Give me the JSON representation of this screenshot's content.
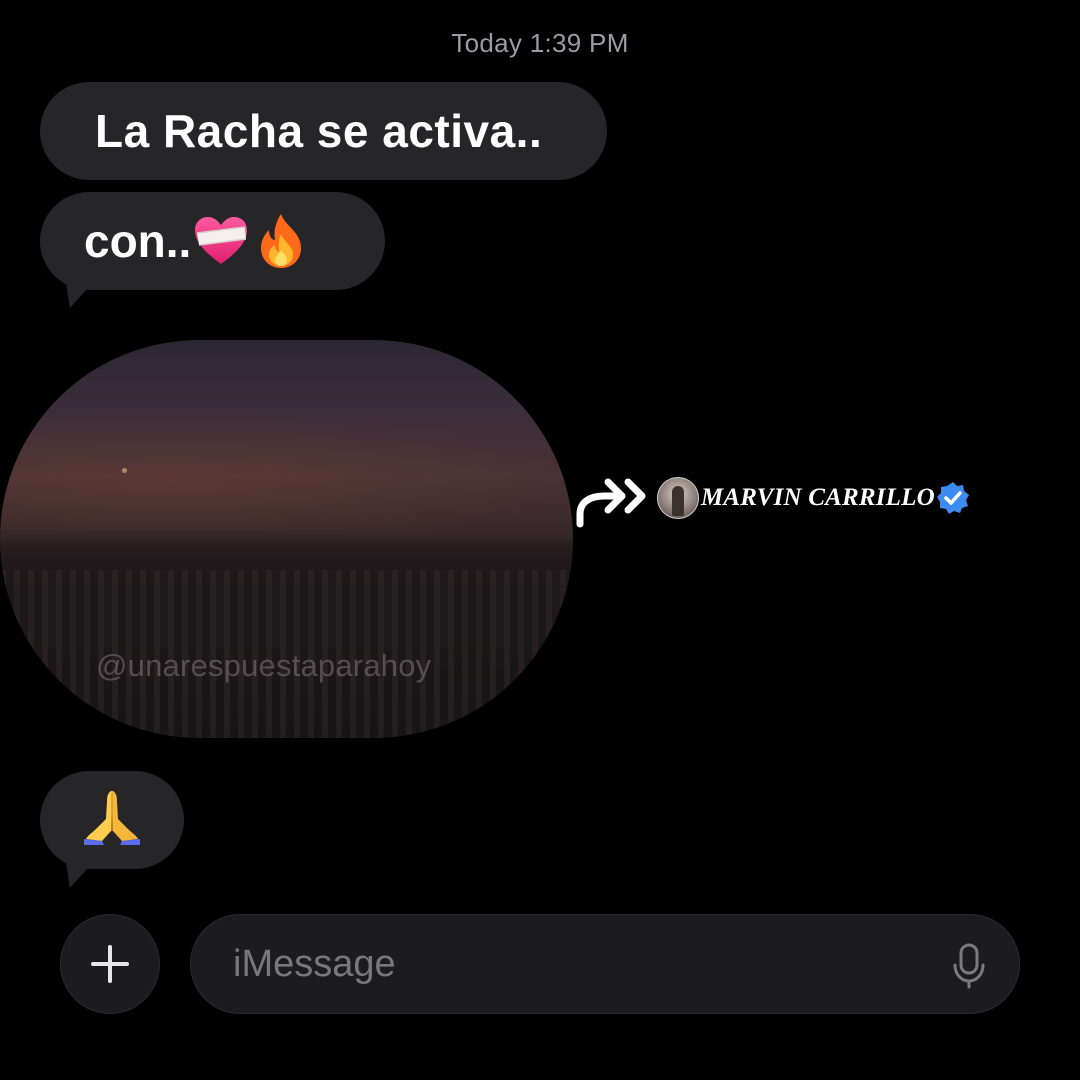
{
  "conversation": {
    "timestamp": "Today 1:39 PM",
    "messages": [
      {
        "text": "La Racha se activa..",
        "emojis": []
      },
      {
        "text": "con..",
        "emojis": [
          "heart-with-bandage",
          "fire"
        ]
      }
    ],
    "video_message": {
      "watermark": "@unarespuestaparahoy"
    },
    "last_message": {
      "emoji": "folded-hands"
    }
  },
  "credit_overlay": {
    "name": "MARVIN CARRILLO",
    "icons": [
      "double-forward-arrow-icon",
      "avatar",
      "verified-badge-icon"
    ],
    "badge_color": "#3b8bf0"
  },
  "composer": {
    "placeholder": "iMessage",
    "add_icon": "plus-icon",
    "mic_icon": "microphone-icon"
  },
  "colors": {
    "background": "#000000",
    "bubble": "#262629",
    "input": "#1c1c1e",
    "timestamp": "#9b9ba0"
  }
}
